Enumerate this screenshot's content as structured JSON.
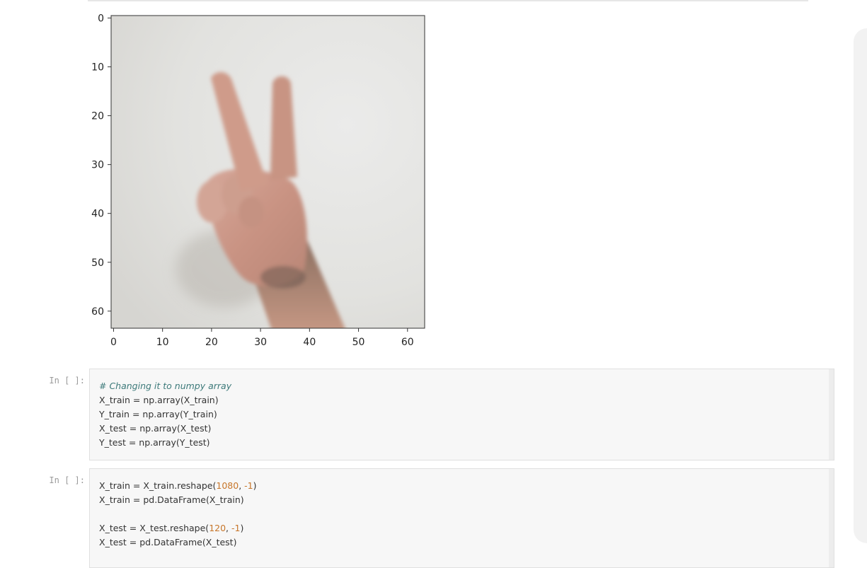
{
  "chart_data": {
    "type": "image",
    "x_ticks": [
      "0",
      "10",
      "20",
      "30",
      "40",
      "50",
      "60"
    ],
    "y_ticks": [
      "0",
      "10",
      "20",
      "30",
      "40",
      "50",
      "60"
    ],
    "xlim": [
      -0.5,
      63.5
    ],
    "ylim": [
      63.5,
      -0.5
    ],
    "image_size": [
      64,
      64
    ],
    "content": "pixelated photo of a hand showing two fingers (peace sign) on a light grey background"
  },
  "cells": [
    {
      "prompt": "In [ ]:",
      "lines": [
        {
          "segments": [
            {
              "text": "# Changing it to numpy array",
              "kind": "comment"
            }
          ]
        },
        {
          "segments": [
            {
              "text": "X_train = np.array(X_train)",
              "kind": "plain"
            }
          ]
        },
        {
          "segments": [
            {
              "text": "Y_train = np.array(Y_train)",
              "kind": "plain"
            }
          ]
        },
        {
          "segments": [
            {
              "text": "X_test = np.array(X_test)",
              "kind": "plain"
            }
          ]
        },
        {
          "segments": [
            {
              "text": "Y_test = np.array(Y_test)",
              "kind": "plain"
            }
          ]
        }
      ]
    },
    {
      "prompt": "In [ ]:",
      "lines": [
        {
          "segments": [
            {
              "text": "X_train = X_train.reshape(",
              "kind": "plain"
            },
            {
              "text": "1080",
              "kind": "num"
            },
            {
              "text": ", ",
              "kind": "plain"
            },
            {
              "text": "-1",
              "kind": "num"
            },
            {
              "text": ")",
              "kind": "plain"
            }
          ]
        },
        {
          "segments": [
            {
              "text": "X_train = pd.DataFrame(X_train)",
              "kind": "plain"
            }
          ]
        },
        {
          "segments": []
        },
        {
          "segments": [
            {
              "text": "X_test = X_test.reshape(",
              "kind": "plain"
            },
            {
              "text": "120",
              "kind": "num"
            },
            {
              "text": ", ",
              "kind": "plain"
            },
            {
              "text": "-1",
              "kind": "num"
            },
            {
              "text": ")",
              "kind": "plain"
            }
          ]
        },
        {
          "segments": [
            {
              "text": "X_test = pd.DataFrame(X_test)",
              "kind": "plain"
            }
          ]
        }
      ]
    }
  ],
  "colors": {
    "background": "#ffffff",
    "cell_bg": "#f7f7f7",
    "comment": "#3d7a7a",
    "number": "#c7762a",
    "prompt": "#9a9a9a"
  }
}
